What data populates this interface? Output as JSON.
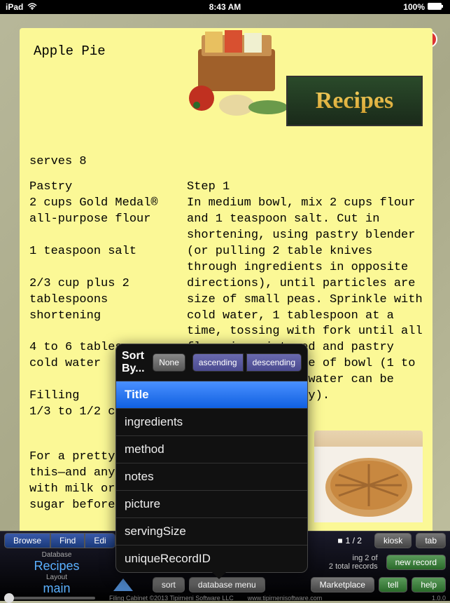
{
  "statusBar": {
    "device": "iPad",
    "time": "8:43 AM",
    "battery": "100%"
  },
  "recipe": {
    "title": "Apple Pie",
    "serves": "serves 8",
    "banner": "Recipes",
    "ingredients": "Pastry\n2 cups Gold Medal®\nall-purpose flour\n\n1 teaspoon salt\n\n2/3 cup plus 2\ntablespoons\nshortening\n\n4 to 6 tablespoons\ncold water\n\nFilling\n1/3 to 1/2 cup sugar",
    "method": "Step 1\nIn medium bowl, mix 2 cups flour and 1 teaspoon salt. Cut in shortening, using pastry blender (or pulling 2 table knives through ingredients in opposite directions), until particles are size of small peas. Sprinkle with cold water, 1 tablespoon at a time, tossing with fork until all flour is moistened and pastry almost cleans side of bowl (1 to 2 teaspoons more water can be added if necessary).",
    "notes": "For a pretty \nthis—and any\nwith milk or\nsugar before\n\nJump-start yo"
  },
  "sortPopover": {
    "title": "Sort By...",
    "noneBtn": "None",
    "ascBtn": "ascending",
    "descBtn": "descending",
    "items": [
      "Title",
      "ingredients",
      "method",
      "notes",
      "picture",
      "servingSize",
      "uniqueRecordID"
    ]
  },
  "toolbar": {
    "browse": "Browse",
    "find": "Find",
    "edit": "Edi",
    "pageIndicator": "1 / 2",
    "kiosk": "kiosk",
    "tab": "tab",
    "dbLabel": "Database",
    "dbValue": "Recipes",
    "recordCount1": "ing 2 of",
    "recordCount2": "2 total records",
    "newRecord": "new record",
    "layoutLabel": "Layout",
    "layoutValue": "main",
    "sort": "sort",
    "dbMenu": "database menu",
    "marketplace": "Marketplace",
    "tell": "tell",
    "help": "help"
  },
  "footer": {
    "copyright": "Filing Cabinet ©2013 Tipirneni Software LLC",
    "url": "www.tipirnenisoftware.com",
    "version": "1.0.0"
  }
}
